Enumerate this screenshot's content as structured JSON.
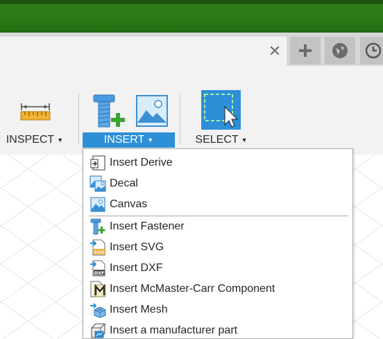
{
  "tabs": {
    "close_glyph": "✕",
    "new_tab_glyph": "+"
  },
  "toolbar": {
    "inspect_label": "INSPECT",
    "insert_label": "INSERT",
    "select_label": "SELECT",
    "caret": "▼"
  },
  "insert_menu": {
    "items": [
      {
        "label": "Insert Derive",
        "icon": "insert-derive-icon"
      },
      {
        "label": "Decal",
        "icon": "decal-icon"
      },
      {
        "label": "Canvas",
        "icon": "canvas-icon"
      },
      {
        "label": "Insert Fastener",
        "icon": "fastener-icon"
      },
      {
        "label": "Insert SVG",
        "icon": "svg-file-icon"
      },
      {
        "label": "Insert DXF",
        "icon": "dxf-file-icon"
      },
      {
        "label": "Insert McMaster-Carr Component",
        "icon": "mcmaster-carr-icon"
      },
      {
        "label": "Insert Mesh",
        "icon": "mesh-icon"
      },
      {
        "label": "Insert a manufacturer part",
        "icon": "manufacturer-part-icon"
      }
    ]
  },
  "colors": {
    "accent": "#2c8fd8",
    "brand_green": "#2a7a17"
  }
}
